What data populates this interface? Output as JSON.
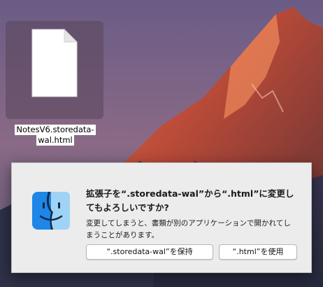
{
  "desktop": {
    "file": {
      "name_line1": "NotesV6.storedata-",
      "name_line2": "wal.html",
      "icon": "document-icon"
    }
  },
  "dialog": {
    "icon": "finder-icon",
    "title": "拡張子を“.storedata-wal”から“.html”に変更してもよろしいですか?",
    "body": "変更してしまうと、書類が別のアプリケーションで開かれてしまうことがあります。",
    "buttons": {
      "keep": "“.storedata-wal”を保持",
      "use": "“.html”を使用"
    }
  },
  "colors": {
    "dialog_bg": "#ececec",
    "button_bg": "#ffffff"
  }
}
